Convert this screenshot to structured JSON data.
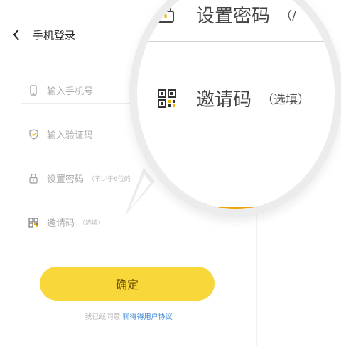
{
  "header": {
    "title": "手机登录"
  },
  "form": {
    "phone_placeholder": "输入手机号",
    "code_placeholder": "输入验证码",
    "password_placeholder": "设置密码",
    "password_hint": "（不少于6位的",
    "invite_label": "邀请码",
    "invite_hint": "（选填）"
  },
  "confirm_label": "确定",
  "agreement": {
    "prefix": "我已经同意",
    "link": "聊得得用户协议"
  },
  "magnifier": {
    "password_label": "设置密码",
    "password_hint_partial": "（/",
    "invite_label": "邀请码",
    "invite_hint": "（选填）"
  },
  "colors": {
    "accent": "#f8d73a",
    "link": "#4a8fd9"
  }
}
